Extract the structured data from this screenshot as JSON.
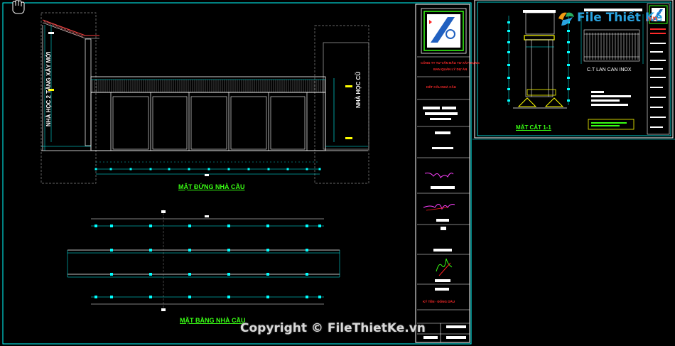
{
  "sheet_main": {
    "elevation_title": "MẶT ĐỨNG NHÀ CẦU",
    "plan_title": "MẶT BẰNG NHÀ CẦU",
    "left_building_label": "NHÀ HỌC 2 TẦNG XÂY MỚI",
    "right_building_label": "NHÀ HỌC CŨ",
    "titleblock": {
      "org_line": "CÔNG TY TƯ VẤN ĐẦU TƯ XÂY DỰNG",
      "project_line": "BAN QUẢN LÝ DỰ ÁN",
      "drawing_line": "KẾT CẤU NHÀ CẦU",
      "bottom_label": "KÝ TÊN - ĐÓNG DẤU"
    }
  },
  "sheet_detail": {
    "section_title": "MẶT CẮT 1-1",
    "railing_title": "C.T LAN CAN INOX"
  },
  "watermark": {
    "logo_text": "File Thiết Kế",
    "logo_suffix": ".vn",
    "copyright": "Copyright © FileThietKe.vn"
  },
  "colors": {
    "background": "#000000",
    "cyan": "#00ffff",
    "white": "#ffffff",
    "green": "#39ff14",
    "magenta": "#ff00ff",
    "red": "#ff2a2a",
    "yellow": "#ffff00"
  },
  "icons": {
    "cursor": "hand-cursor-icon",
    "logo": "filethietke-logo-icon"
  }
}
